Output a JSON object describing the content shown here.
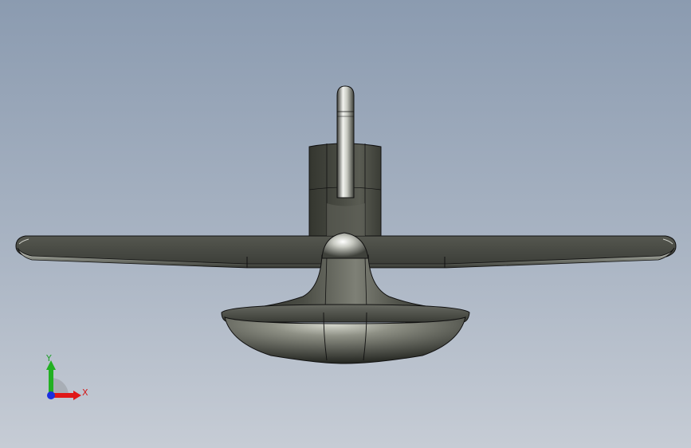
{
  "scene": {
    "background_top": "#8b9bb0",
    "background_bottom": "#c6ccd5",
    "model_color": "#3f423e",
    "edge_color": "#111111"
  },
  "triad": {
    "x_label": "X",
    "y_label": "Y",
    "x_color": "#e01818",
    "y_color": "#22b022",
    "z_color": "#1a2fe0"
  }
}
